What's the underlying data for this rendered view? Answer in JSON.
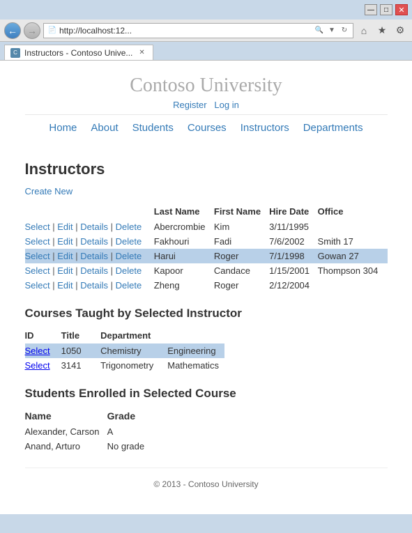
{
  "browser": {
    "address": "http://localhost:12...",
    "tab_title": "Instructors - Contoso Unive...",
    "title_bar_buttons": {
      "minimize": "—",
      "maximize": "□",
      "close": "✕"
    }
  },
  "site": {
    "title": "Contoso University",
    "auth": {
      "register": "Register",
      "login": "Log in"
    },
    "nav": [
      "Home",
      "About",
      "Students",
      "Courses",
      "Instructors",
      "Departments"
    ]
  },
  "page": {
    "heading": "Instructors",
    "create_new": "Create New",
    "instructors_table": {
      "columns": [
        "Last Name",
        "First Name",
        "Hire Date",
        "Office"
      ],
      "rows": [
        {
          "last": "Abercrombie",
          "first": "Kim",
          "hire_date": "3/11/1995",
          "office": "",
          "highlighted": false
        },
        {
          "last": "Fakhouri",
          "first": "Fadi",
          "hire_date": "7/6/2002",
          "office": "Smith 17",
          "highlighted": false
        },
        {
          "last": "Harui",
          "first": "Roger",
          "hire_date": "7/1/1998",
          "office": "Gowan 27",
          "highlighted": true
        },
        {
          "last": "Kapoor",
          "first": "Candace",
          "hire_date": "1/15/2001",
          "office": "Thompson 304",
          "highlighted": false
        },
        {
          "last": "Zheng",
          "first": "Roger",
          "hire_date": "2/12/2004",
          "office": "",
          "highlighted": false
        }
      ],
      "actions": [
        "Select",
        "Edit",
        "Details",
        "Delete"
      ]
    },
    "courses_section": {
      "heading": "Courses Taught by Selected Instructor",
      "columns": [
        "ID",
        "Title",
        "Department"
      ],
      "rows": [
        {
          "id": "1050",
          "title": "Chemistry",
          "department": "Engineering",
          "highlighted": true
        },
        {
          "id": "3141",
          "title": "Trigonometry",
          "department": "Mathematics",
          "highlighted": false
        }
      ]
    },
    "students_section": {
      "heading": "Students Enrolled in Selected Course",
      "columns": [
        "Name",
        "Grade"
      ],
      "rows": [
        {
          "name": "Alexander, Carson",
          "grade": "A"
        },
        {
          "name": "Anand, Arturo",
          "grade": "No grade"
        }
      ]
    },
    "footer": "© 2013 - Contoso University"
  }
}
